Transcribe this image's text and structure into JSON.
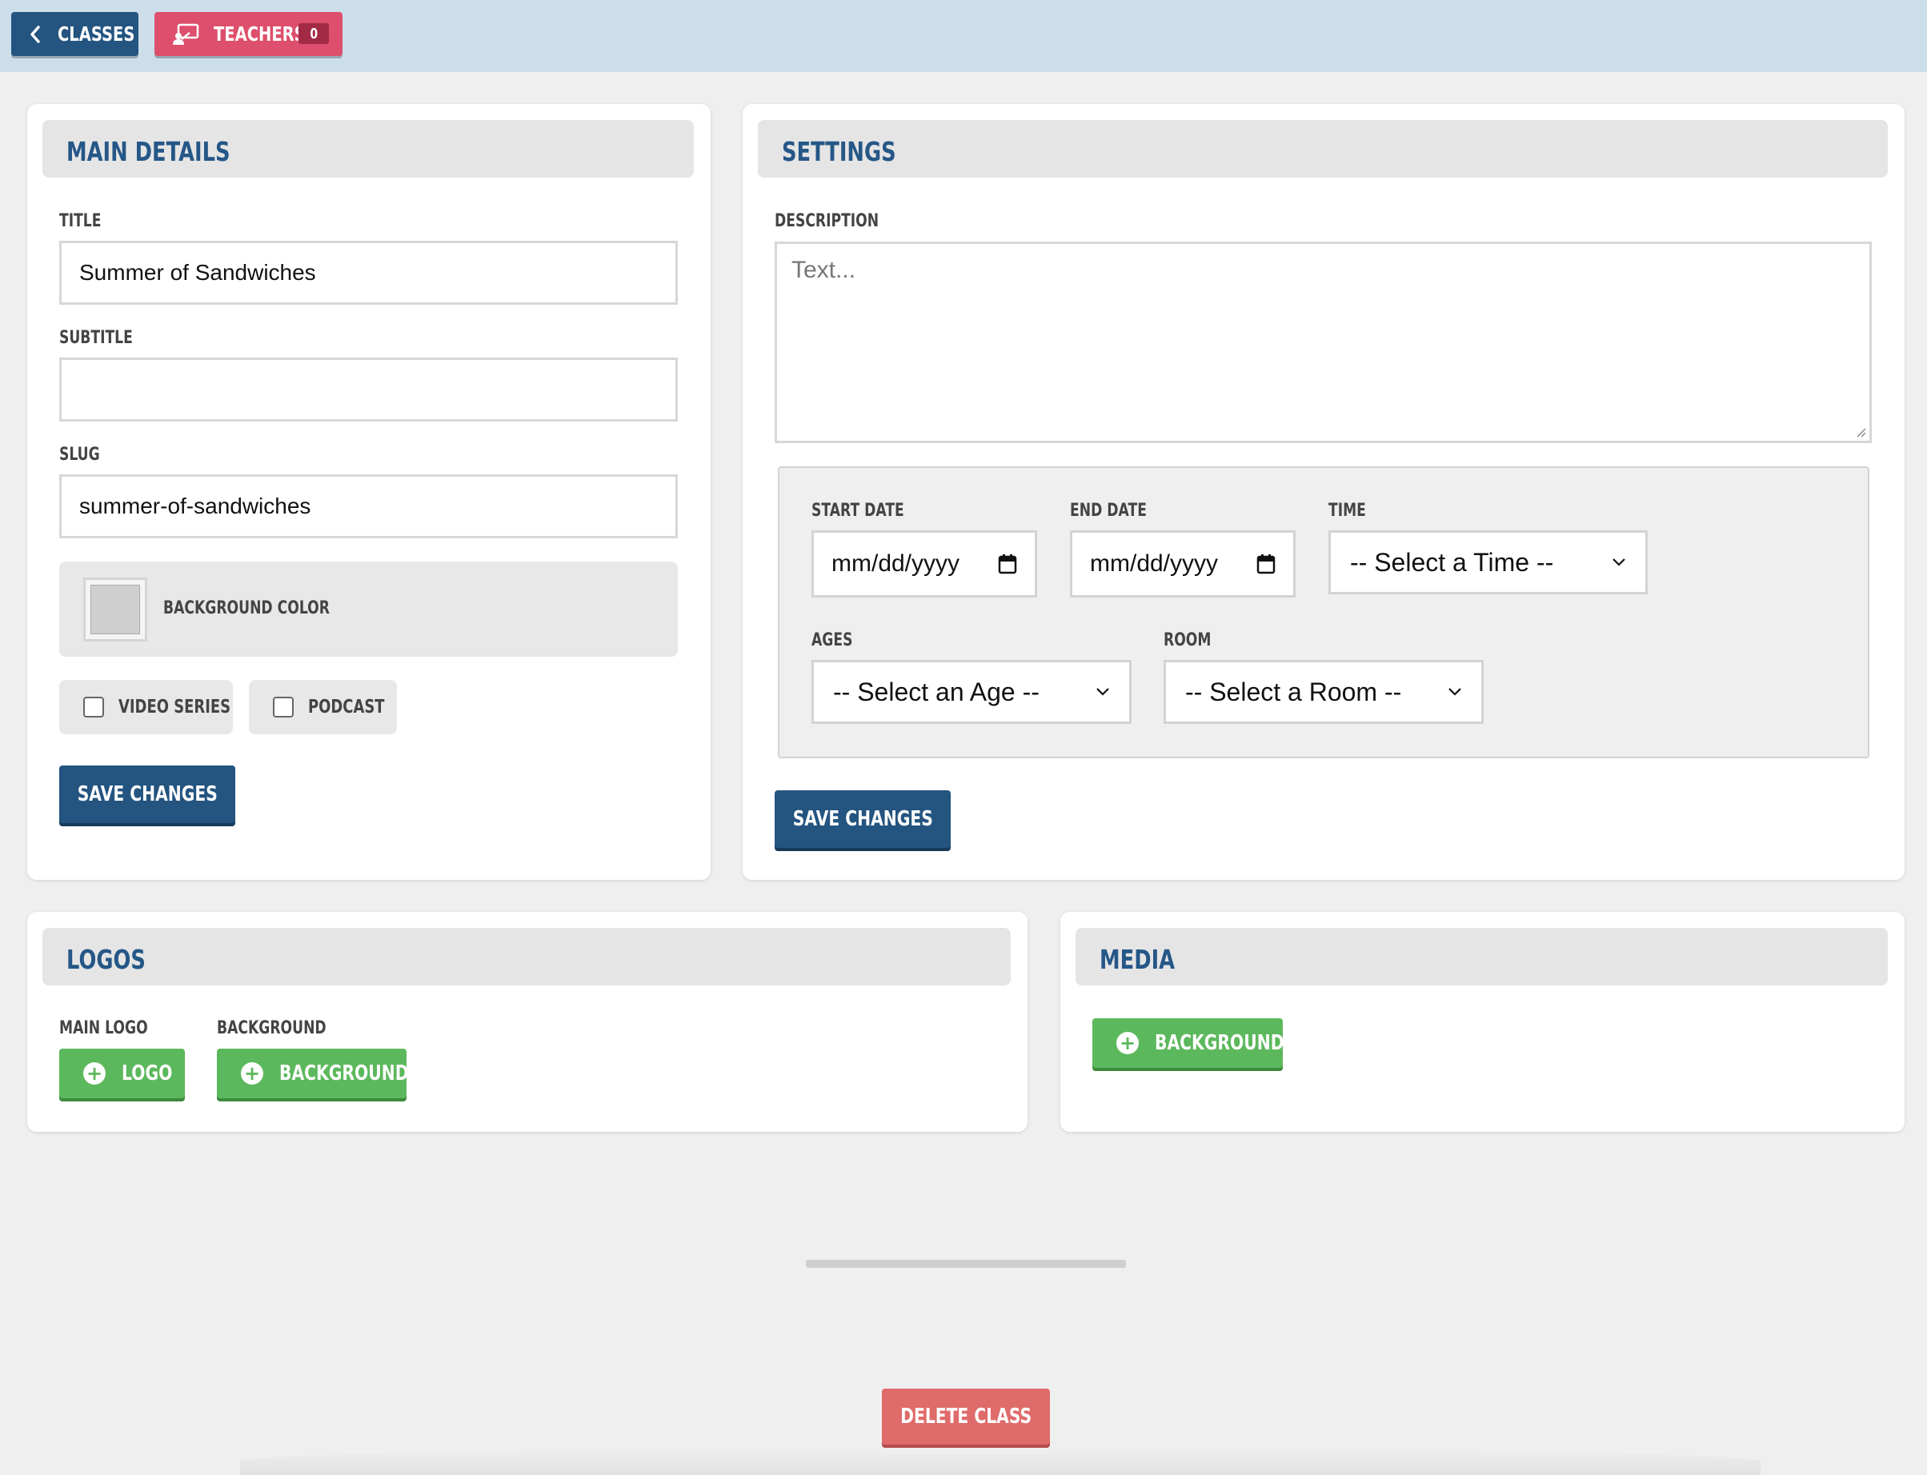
{
  "nav": {
    "classes_label": "Classes",
    "teachers_label": "Teachers",
    "teachers_count": "0"
  },
  "main_details": {
    "heading": "Main Details",
    "title_label": "Title",
    "title_value": "Summer of Sandwiches",
    "subtitle_label": "Subtitle",
    "subtitle_value": "",
    "slug_label": "Slug",
    "slug_value": "summer-of-sandwiches",
    "background_color_label": "Background Color",
    "background_color_value": "#cfcfcf",
    "video_series_label": "Video Series",
    "podcast_label": "Podcast",
    "save_label": "Save Changes"
  },
  "settings": {
    "heading": "Settings",
    "description_label": "Description",
    "description_placeholder": "Text...",
    "start_date_label": "Start Date",
    "start_date_placeholder": "mm/dd/yyyy",
    "end_date_label": "End Date",
    "end_date_placeholder": "mm/dd/yyyy",
    "time_label": "Time",
    "time_selected": "-- Select a Time --",
    "ages_label": "Ages",
    "ages_selected": "-- Select an Age --",
    "room_label": "Room",
    "room_selected": "-- Select a Room --",
    "save_label": "Save Changes"
  },
  "logos": {
    "heading": "Logos",
    "main_logo_label": "Main Logo",
    "main_logo_button": "Logo",
    "background_label": "Background",
    "background_button": "Background"
  },
  "media": {
    "heading": "Media",
    "background_button": "Background"
  },
  "footer": {
    "delete_label": "Delete Class"
  },
  "colors": {
    "primary": "#245480",
    "heading_text": "#255787",
    "teachers": "#dd4f6c",
    "success": "#5cb85c",
    "danger": "#df6b6a",
    "topbar": "#cddeeb"
  },
  "icons": {
    "classes_back": "chevron-left-icon",
    "teachers": "teacher-board-icon",
    "add": "plus-circle-icon",
    "calendar": "calendar-icon",
    "select_arrow": "chevron-down-icon"
  }
}
